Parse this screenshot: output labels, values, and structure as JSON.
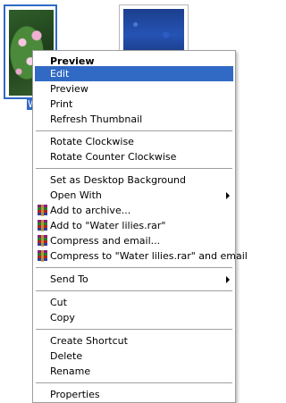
{
  "thumbnails": [
    {
      "letter": "W"
    },
    {}
  ],
  "menu": {
    "items": [
      {
        "label": "Preview",
        "bold": true
      },
      {
        "label": "Edit",
        "highlighted": true
      },
      {
        "label": "Preview"
      },
      {
        "label": "Print"
      },
      {
        "label": "Refresh Thumbnail"
      },
      {
        "label": "Rotate Clockwise"
      },
      {
        "label": "Rotate Counter Clockwise"
      },
      {
        "label": "Set as Desktop Background"
      },
      {
        "label": "Open With",
        "submenu": true
      },
      {
        "label": "Add to archive...",
        "icon": "winrar-icon"
      },
      {
        "label": "Add to \"Water lilies.rar\"",
        "icon": "winrar-icon"
      },
      {
        "label": "Compress and email...",
        "icon": "winrar-icon"
      },
      {
        "label": "Compress to \"Water lilies.rar\" and email",
        "icon": "winrar-icon"
      },
      {
        "label": "Send To",
        "submenu": true
      },
      {
        "label": "Cut"
      },
      {
        "label": "Copy"
      },
      {
        "label": "Create Shortcut"
      },
      {
        "label": "Delete"
      },
      {
        "label": "Rename"
      },
      {
        "label": "Properties"
      }
    ]
  },
  "colors": {
    "highlight": "#316ac5",
    "selection_border": "#3169c6"
  }
}
